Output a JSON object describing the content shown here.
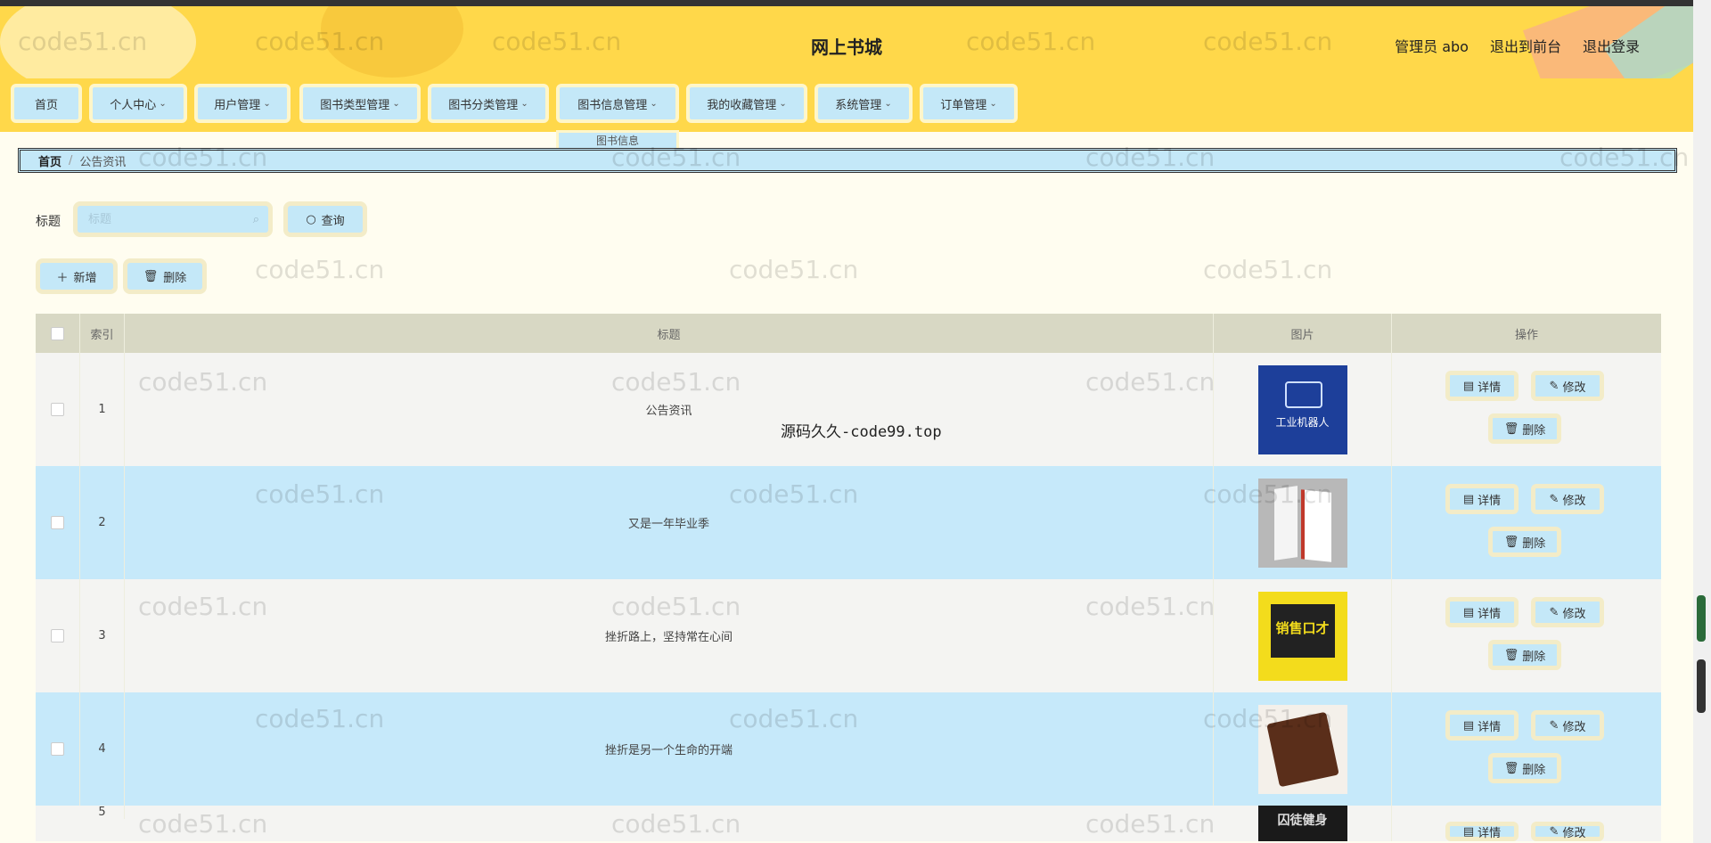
{
  "header": {
    "site_title": "网上书城",
    "user_label": "管理员 abo",
    "to_front_label": "退出到前台",
    "logout_label": "退出登录"
  },
  "nav": {
    "items": [
      {
        "label": "首页",
        "has_menu": false
      },
      {
        "label": "个人中心",
        "has_menu": true
      },
      {
        "label": "用户管理",
        "has_menu": true
      },
      {
        "label": "图书类型管理",
        "has_menu": true
      },
      {
        "label": "图书分类管理",
        "has_menu": true
      },
      {
        "label": "图书信息管理",
        "has_menu": true
      },
      {
        "label": "我的收藏管理",
        "has_menu": true
      },
      {
        "label": "系统管理",
        "has_menu": true
      },
      {
        "label": "订单管理",
        "has_menu": true
      }
    ],
    "open_dropdown": {
      "parent": "图书信息管理",
      "items": [
        "图书信息"
      ]
    }
  },
  "breadcrumb": {
    "home": "首页",
    "sep": "/",
    "current": "公告资讯"
  },
  "search": {
    "label": "标题",
    "placeholder": "标题",
    "value": "",
    "button_label": "查询"
  },
  "toolbar": {
    "add_label": "新增",
    "delete_label": "删除"
  },
  "table": {
    "columns": [
      "索引",
      "标题",
      "图片",
      "操作"
    ],
    "rows": [
      {
        "index": "1",
        "title": "公告资讯",
        "cover_text": "工业机器人"
      },
      {
        "index": "2",
        "title": "又是一年毕业季",
        "cover_text": ""
      },
      {
        "index": "3",
        "title": "挫折路上，坚持常在心间",
        "cover_text": "销售口才"
      },
      {
        "index": "4",
        "title": "挫折是另一个生命的开端",
        "cover_text": ""
      },
      {
        "index": "5",
        "title": "",
        "cover_text": "囚徒健身"
      }
    ],
    "row_actions": {
      "detail": "详情",
      "edit": "修改",
      "delete": "删除"
    }
  },
  "overlay_text": "源码久久-code99.top",
  "watermark": "code51.cn",
  "colors": {
    "header_bg": "#ffd84a",
    "button_bg": "#c4e8f8",
    "row_alt": "#c6e9fa",
    "thead_bg": "#d8d8c4"
  }
}
